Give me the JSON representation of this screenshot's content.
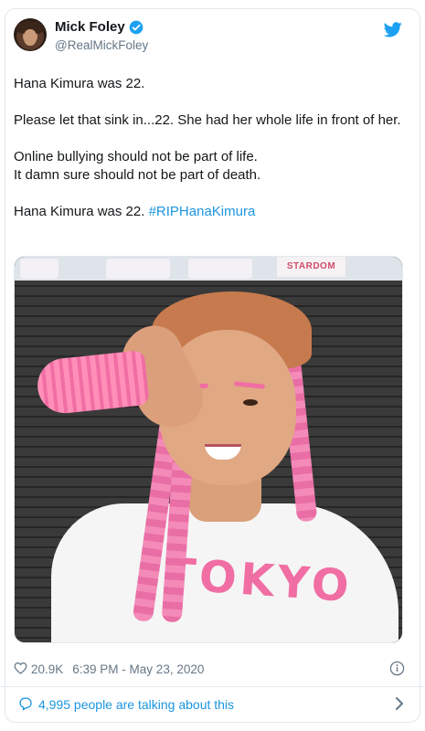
{
  "tweet": {
    "author": {
      "name": "Mick Foley",
      "handle": "@RealMickFoley",
      "verified": true
    },
    "paragraphs": [
      [
        "Hana Kimura was 22."
      ],
      [
        "Please let that sink in...22. She had her whole life in front of her."
      ],
      [
        "Online bullying should not be part of life.",
        "It damn sure should not be part of death."
      ]
    ],
    "last_line_text": "Hana Kimura was 22. ",
    "hashtag": "#RIPHanaKimura",
    "photo": {
      "banner_text": "STARDOM",
      "shirt_text": "TOKYO"
    },
    "likes": "20.9K",
    "timestamp": "6:39 PM - May 23, 2020",
    "talking": "4,995 people are talking about this"
  },
  "colors": {
    "link": "#1b95e0",
    "muted": "#657786",
    "twitter_blue": "#1da1f2"
  },
  "icons": [
    "verified-badge-icon",
    "twitter-bird-icon",
    "heart-icon",
    "info-icon",
    "speech-bubble-icon",
    "chevron-right-icon"
  ]
}
